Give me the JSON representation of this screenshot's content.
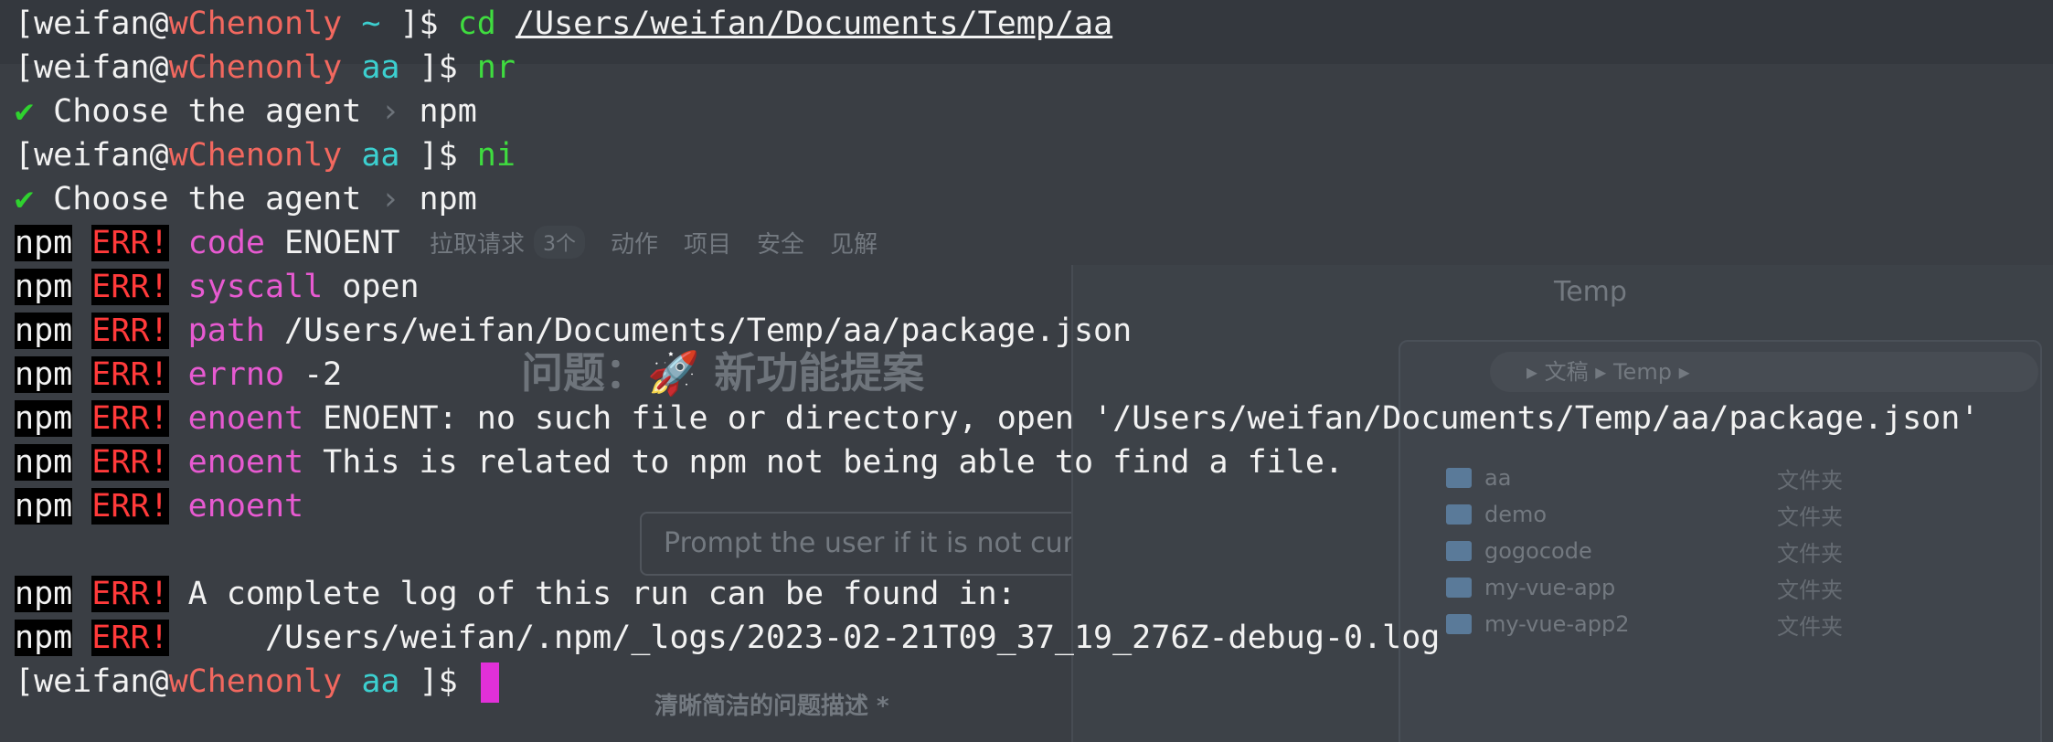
{
  "background_window": {
    "tabs": [
      {
        "label": "拉取请求",
        "count": "3个"
      },
      {
        "label": "动作"
      },
      {
        "label": "项目"
      },
      {
        "label": "安全"
      },
      {
        "label": "见解"
      }
    ],
    "title": "问题：🚀 新功能提案",
    "prompt_input_placeholder": "Prompt the user if it is not curr",
    "field_label": "清晰简洁的问题描述 *",
    "finder": {
      "title": "Temp",
      "path": "▸ 文稿 ▸ Temp ▸",
      "files": [
        {
          "name": "aa",
          "kind": "文件夹"
        },
        {
          "name": "demo",
          "kind": "文件夹"
        },
        {
          "name": "gogocode",
          "kind": "文件夹"
        },
        {
          "name": "my-vue-app",
          "kind": "文件夹"
        },
        {
          "name": "my-vue-app2",
          "kind": "文件夹"
        }
      ]
    }
  },
  "terminal": {
    "prompt": {
      "user": "[weifan@",
      "host": "wChenonly",
      "close": " ]$ "
    },
    "commands": [
      {
        "cwd": "~",
        "cmd": "cd",
        "arg": "/Users/weifan/Documents/Temp/aa"
      },
      {
        "cwd": "aa",
        "cmd": "nr"
      },
      {
        "cwd": "aa",
        "cmd": "ni"
      }
    ],
    "agent_prompt": {
      "check": "✔",
      "text": "Choose the agent",
      "sep": "›",
      "value": "npm"
    },
    "npm_label": "npm",
    "err_label": "ERR!",
    "errors": [
      {
        "key": "code",
        "value": " ENOENT"
      },
      {
        "key": "syscall",
        "value": " open"
      },
      {
        "key": "path",
        "value": " /Users/weifan/Documents/Temp/aa/package.json"
      },
      {
        "key": "errno",
        "value": " -2"
      },
      {
        "key": "enoent",
        "value": " ENOENT: no such file or directory, open '/Users/weifan/Documents/Temp/aa/package.json'"
      },
      {
        "key": "enoent",
        "value": " This is related to npm not being able to find a file."
      },
      {
        "key": "enoent",
        "value": ""
      }
    ],
    "log_lines": [
      " A complete log of this run can be found in:",
      "     /Users/weifan/.npm/_logs/2023-02-21T09_37_19_276Z-debug-0.log"
    ],
    "final_cwd": "aa"
  },
  "colors": {
    "host": "#f2685f",
    "cwd": "#3ccfcf",
    "command": "#3fdc3f",
    "err": "#ff3a3a",
    "key": "#e75ad1",
    "cursor": "#e130d8"
  }
}
